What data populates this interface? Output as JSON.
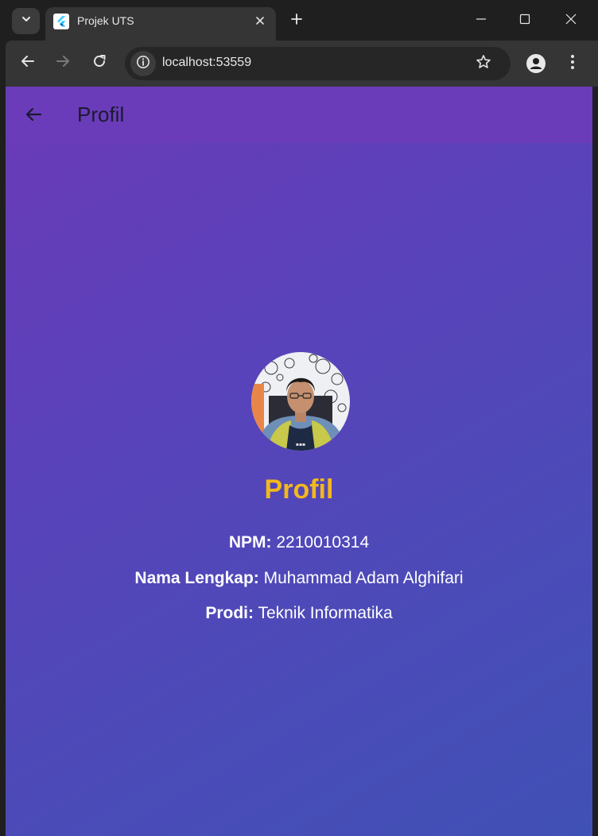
{
  "browser": {
    "tab_title": "Projek UTS",
    "url": "localhost:53559"
  },
  "app": {
    "appbar_title": "Profil",
    "heading": "Profil",
    "heading_color": "#f3b81b",
    "fields": [
      {
        "label": "NPM:",
        "value": "2210010314"
      },
      {
        "label": "Nama Lengkap:",
        "value": "Muhammad Adam Alghifari"
      },
      {
        "label": "Prodi:",
        "value": "Teknik Informatika"
      }
    ]
  },
  "icons": {
    "tab_search": "chevron-down-icon",
    "favicon": "flutter-logo",
    "tab_close": "close-icon",
    "new_tab": "plus-icon",
    "back": "arrow-left-icon",
    "forward": "arrow-right-icon",
    "reload": "reload-icon",
    "site_info": "info-icon",
    "bookmark": "star-icon",
    "profile": "person-icon",
    "menu": "kebab-menu-icon"
  }
}
